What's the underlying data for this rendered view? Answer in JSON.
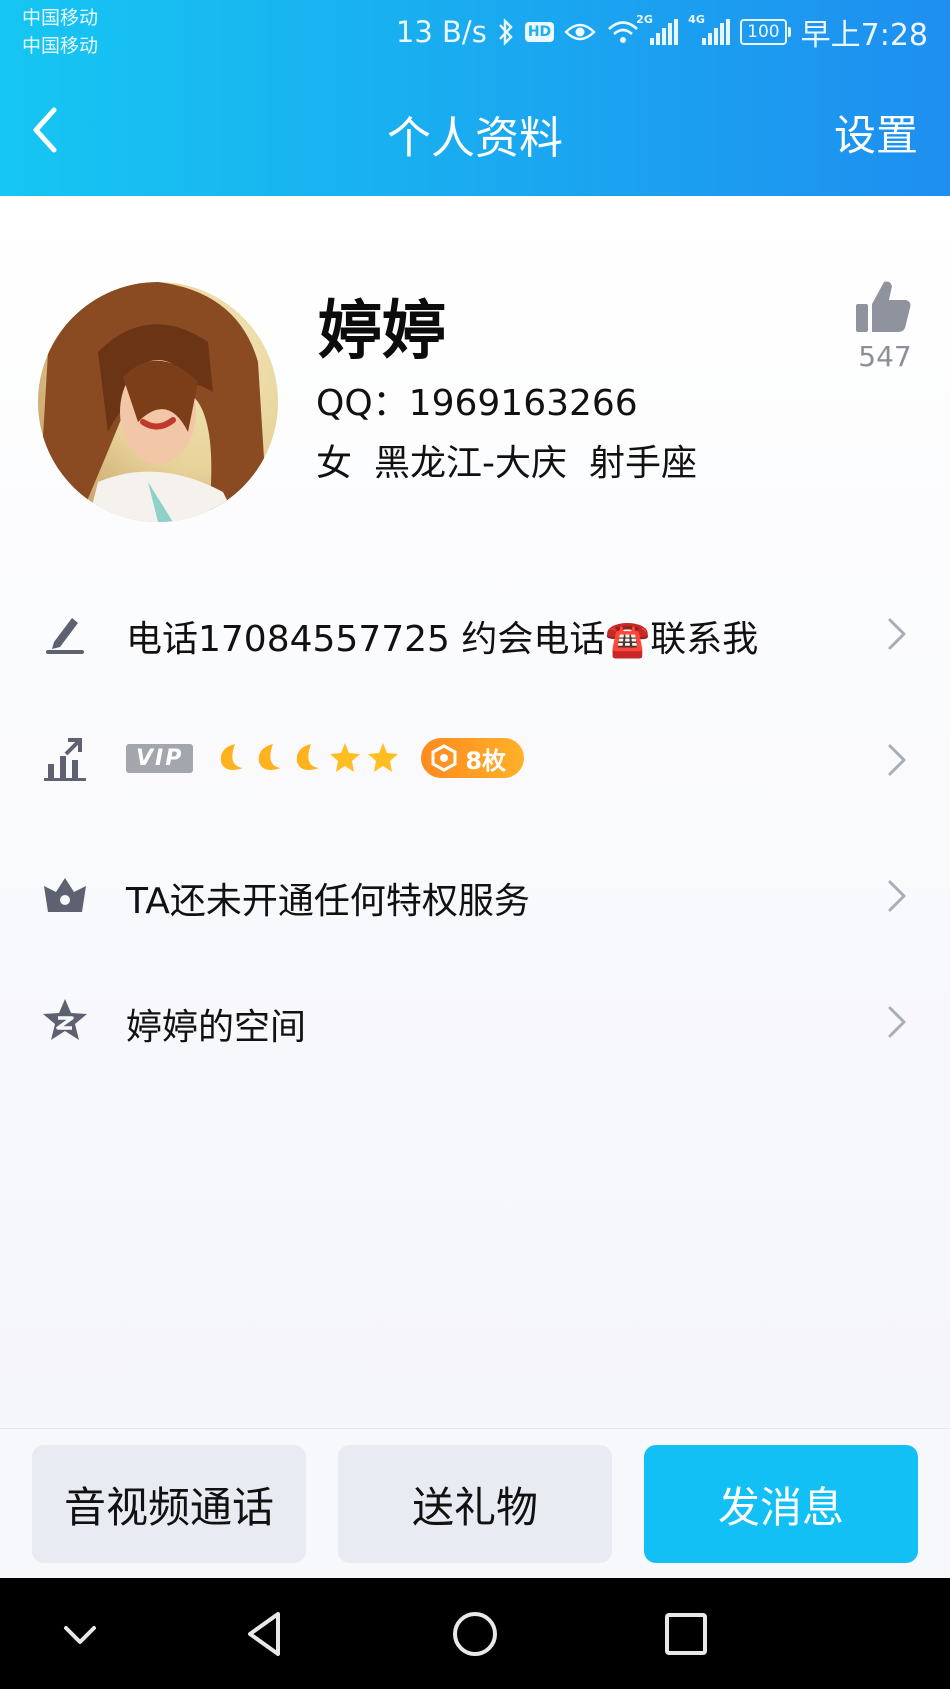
{
  "status_bar": {
    "carrier_1": "中国移动",
    "carrier_2": "中国移动",
    "net_speed": "13 B/s",
    "hd": "HD",
    "sim1_label": "2G",
    "sim2_label": "4G",
    "battery": "100",
    "time": "早上7:28"
  },
  "nav": {
    "title": "个人资料",
    "settings_label": "设置"
  },
  "profile": {
    "nickname": "婷婷",
    "qq": "QQ：1969163266",
    "gender": "女",
    "location": "黑龙江-大庆",
    "zodiac": "射手座",
    "like_count": "547"
  },
  "rows": {
    "signature": "电话17084557725  约会电话☎️联系我",
    "vip_label": "VIP",
    "medal_count": "8枚",
    "privilege": "TA还未开通任何特权服务",
    "space": "婷婷的空间"
  },
  "actions": {
    "call": "音视频通话",
    "gift": "送礼物",
    "message": "发消息"
  },
  "colors": {
    "header_start": "#16c6f2",
    "header_end": "#1e8ff0",
    "primary_button": "#12c0f5",
    "medal": "#ff9a20"
  }
}
